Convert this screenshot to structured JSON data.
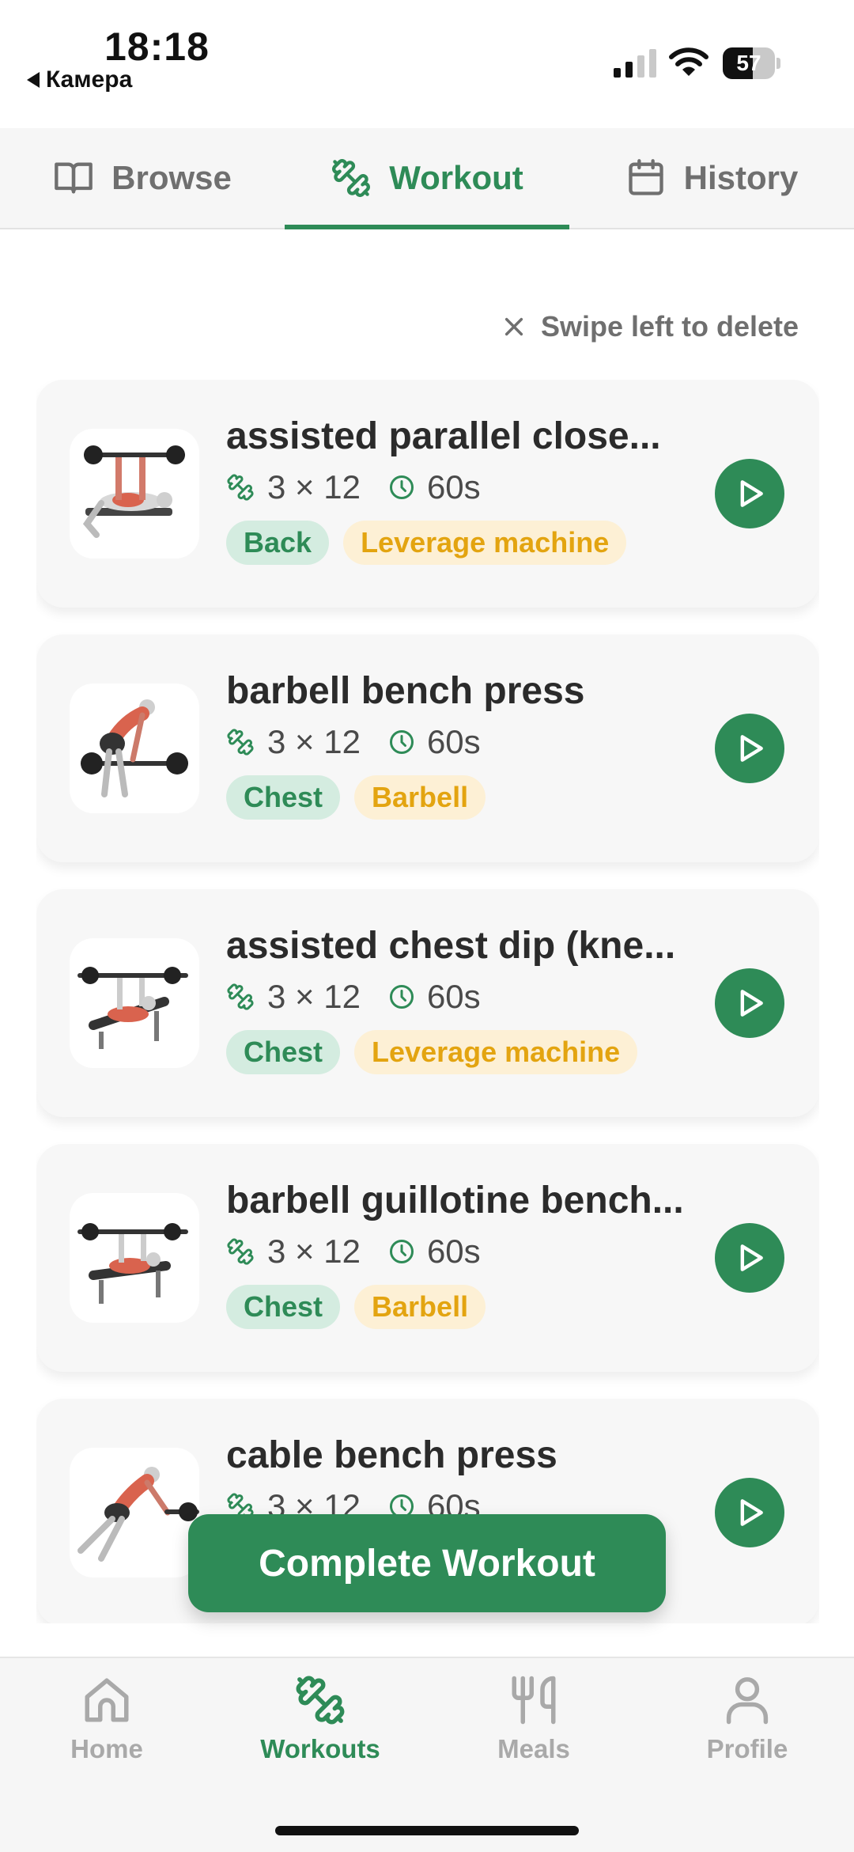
{
  "status_bar": {
    "time": "18:18",
    "back_app": "Камера",
    "battery_level": "57",
    "battery_fraction": 0.57
  },
  "top_tabs": [
    {
      "label": "Browse",
      "icon": "book-icon",
      "active": false
    },
    {
      "label": "Workout",
      "icon": "dumbbell-icon",
      "active": true
    },
    {
      "label": "History",
      "icon": "calendar-icon",
      "active": false
    }
  ],
  "hint": "Swipe left to delete",
  "exercises": [
    {
      "name": "assisted parallel close...",
      "sets": "3 × 12",
      "rest": "60s",
      "muscle": "Back",
      "equipment": "Leverage machine"
    },
    {
      "name": "barbell bench press",
      "sets": "3 × 12",
      "rest": "60s",
      "muscle": "Chest",
      "equipment": "Barbell"
    },
    {
      "name": "assisted chest dip (kne...",
      "sets": "3 × 12",
      "rest": "60s",
      "muscle": "Chest",
      "equipment": "Leverage machine"
    },
    {
      "name": "barbell guillotine bench...",
      "sets": "3 × 12",
      "rest": "60s",
      "muscle": "Chest",
      "equipment": "Barbell"
    },
    {
      "name": "cable bench press",
      "sets": "3 × 12",
      "rest": "60s",
      "muscle": "",
      "equipment": ""
    }
  ],
  "complete_button": "Complete Workout",
  "bottom_nav": [
    {
      "label": "Home",
      "icon": "home-icon",
      "active": false
    },
    {
      "label": "Workouts",
      "icon": "dumbbell-icon",
      "active": true
    },
    {
      "label": "Meals",
      "icon": "fork-knife-icon",
      "active": false
    },
    {
      "label": "Profile",
      "icon": "person-icon",
      "active": false
    }
  ],
  "colors": {
    "accent": "#2e8b57",
    "muscle_tag_bg": "#d4ece0",
    "equipment_tag_bg": "#fdf0d5",
    "equipment_tag_text": "#e3a410",
    "inactive": "#a9a9a9"
  }
}
